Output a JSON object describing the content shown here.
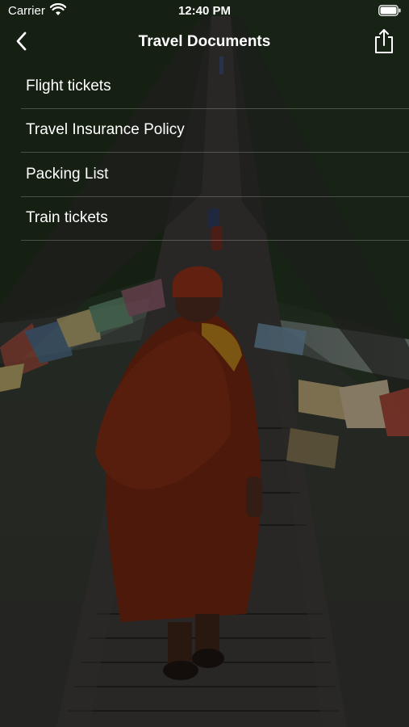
{
  "status_bar": {
    "carrier": "Carrier",
    "time": "12:40 PM"
  },
  "nav": {
    "title": "Travel Documents",
    "back_icon": "chevron-left-icon",
    "share_icon": "share-icon"
  },
  "documents": [
    {
      "label": "Flight tickets"
    },
    {
      "label": "Travel Insurance Policy"
    },
    {
      "label": "Packing List"
    },
    {
      "label": "Train tickets"
    }
  ],
  "colors": {
    "text": "#ffffff",
    "separator": "#ffffff38",
    "robe": "#7a2a10"
  }
}
